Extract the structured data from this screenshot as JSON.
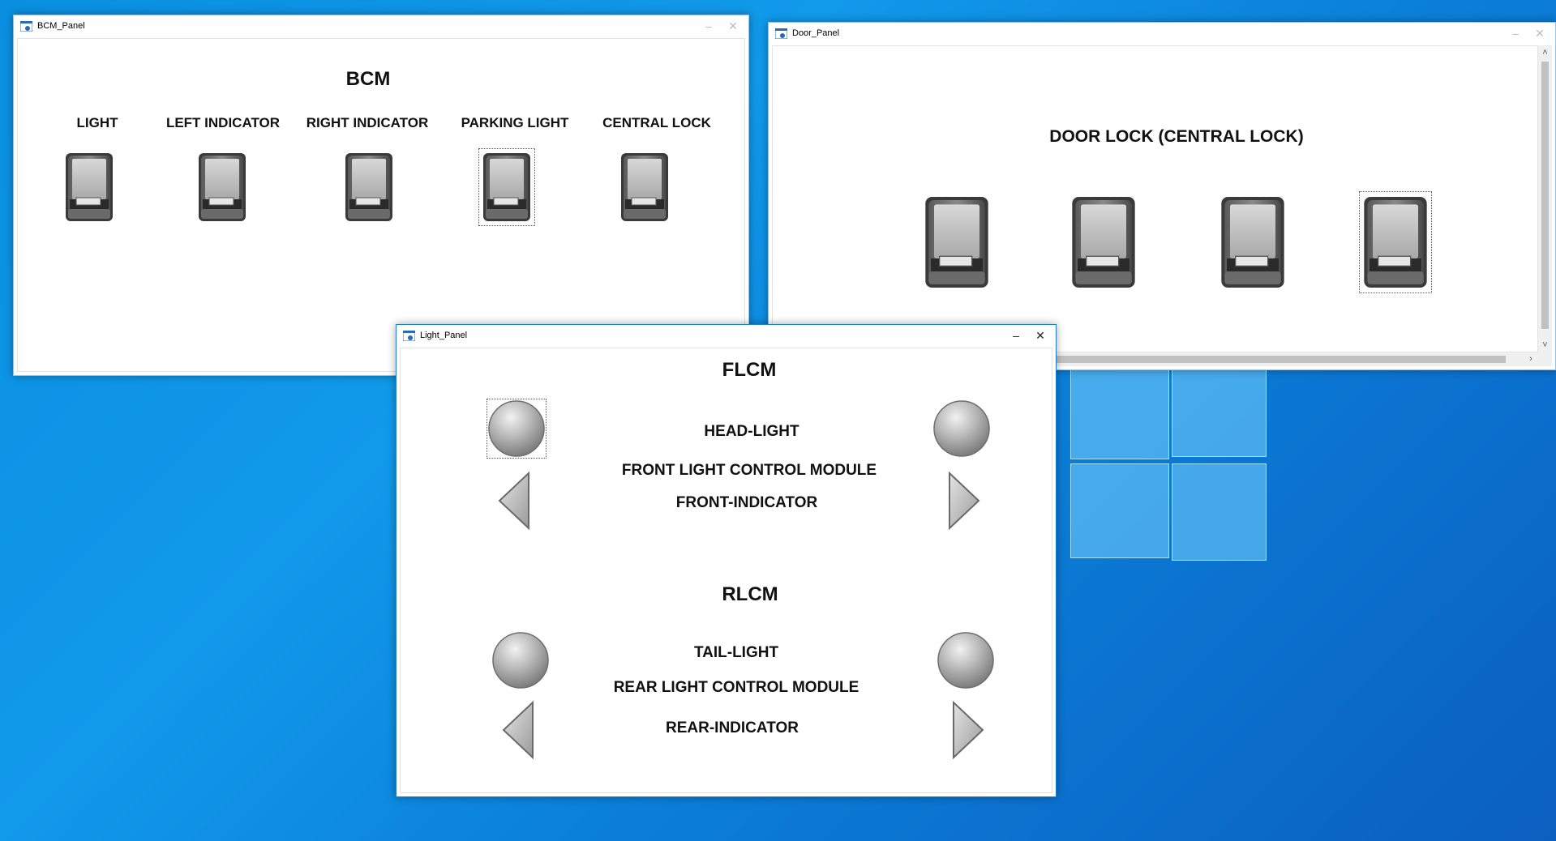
{
  "bcm_panel": {
    "title": "BCM_Panel",
    "heading": "BCM",
    "switch_labels": [
      "LIGHT",
      "LEFT INDICATOR",
      "RIGHT INDICATOR",
      "PARKING LIGHT",
      "CENTRAL LOCK"
    ],
    "focused_switch": "PARKING LIGHT"
  },
  "door_panel": {
    "title": "Door_Panel",
    "heading": "DOOR LOCK (CENTRAL LOCK)",
    "switch_count": 4
  },
  "light_panel": {
    "title": "Light_Panel",
    "flcm_heading": "FLCM",
    "head_light_label": "HEAD-LIGHT",
    "front_module_label": "FRONT LIGHT CONTROL MODULE",
    "front_indicator_label": "FRONT-INDICATOR",
    "rlcm_heading": "RLCM",
    "tail_light_label": "TAIL-LIGHT",
    "rear_module_label": "REAR LIGHT CONTROL MODULE",
    "rear_indicator_label": "REAR-INDICATOR"
  },
  "window_controls": {
    "minimize": "–",
    "close": "✕"
  },
  "scroll_arrows": {
    "up": "˄",
    "down": "˅",
    "right": "›"
  }
}
